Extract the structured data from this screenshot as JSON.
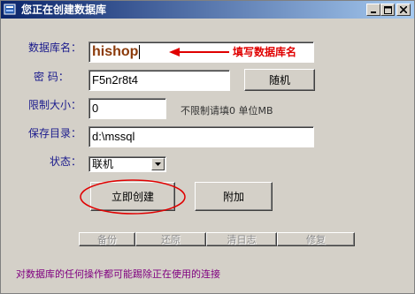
{
  "window": {
    "title": "您正在创建数据库"
  },
  "form": {
    "dbname_label": "数据库名：",
    "dbname_value": "hishop",
    "password_label": "密 码：",
    "password_value": "F5n2r8t4",
    "random_label": "随机",
    "size_label": "限制大小：",
    "size_value": "0",
    "size_note": "不限制请填0 单位MB",
    "dir_label": "保存目录：",
    "dir_value": "d:\\mssql",
    "status_label": "状态：",
    "status_value": "联机"
  },
  "annotation": {
    "text": "填写数据库名",
    "color": "#e00000"
  },
  "actions": {
    "create_label": "立即创建",
    "attach_label": "附加"
  },
  "ops": {
    "backup_label": "备份",
    "restore_label": "还原",
    "clearlog_label": "清日志",
    "repair_label": "修复"
  },
  "footer": {
    "warning": "对数据库的任何操作都可能踢除正在使用的连接"
  }
}
